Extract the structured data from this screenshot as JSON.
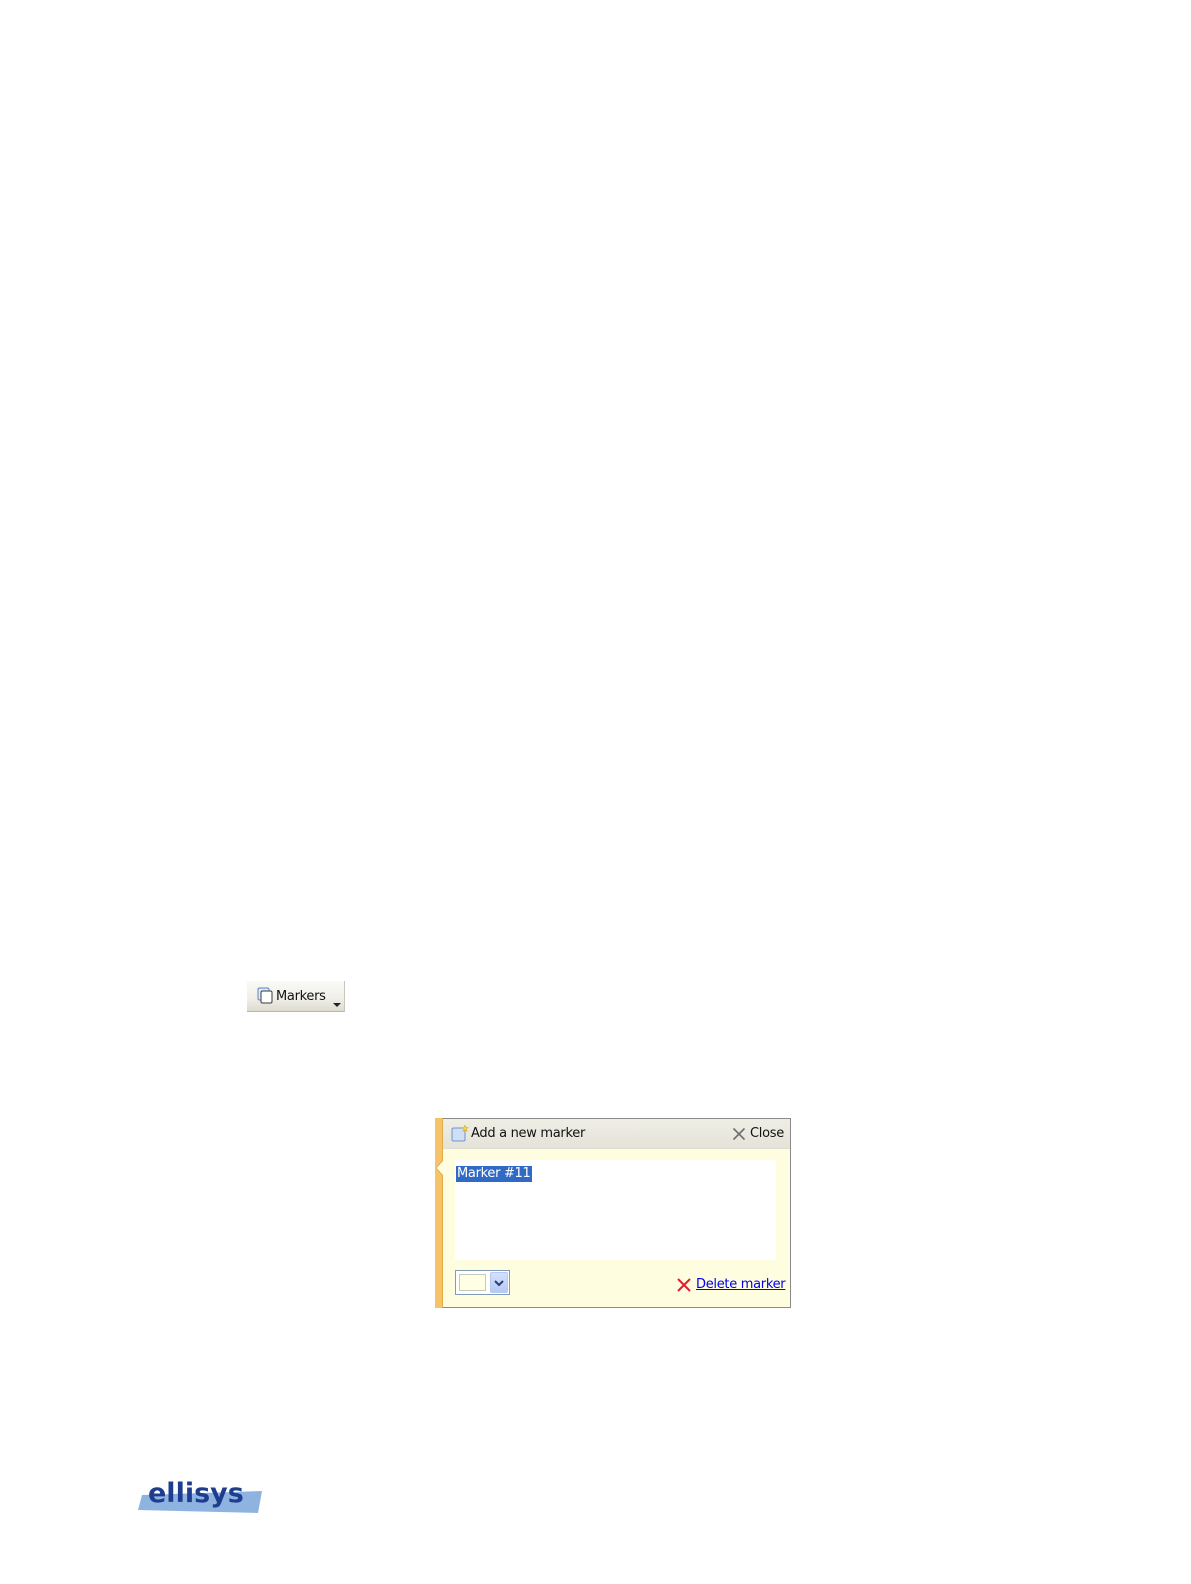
{
  "toolbar": {
    "markers_button": {
      "label": "Markers",
      "icon": "markers-icon",
      "dropdown_icon": "caret-down-icon"
    }
  },
  "marker_popup": {
    "header": {
      "add_label": "Add a new marker",
      "add_icon": "add-marker-icon",
      "close_label": "Close",
      "close_icon": "close-icon"
    },
    "text_value": "Marker #11",
    "color_picker": {
      "selected_color": "#ffffe6",
      "dropdown_icon": "chevron-down-icon"
    },
    "delete_label": "Delete marker",
    "delete_icon": "delete-x-icon",
    "colors": {
      "accent": "#f5c36a",
      "panel_background": "#fffde0",
      "selection": "#316ac5",
      "link": "#0000ee",
      "delete_x": "#e0202f"
    }
  },
  "logo": {
    "text": "ellisys",
    "colors": {
      "text": "#1f3d8f",
      "band": "#8fb3e0"
    }
  }
}
